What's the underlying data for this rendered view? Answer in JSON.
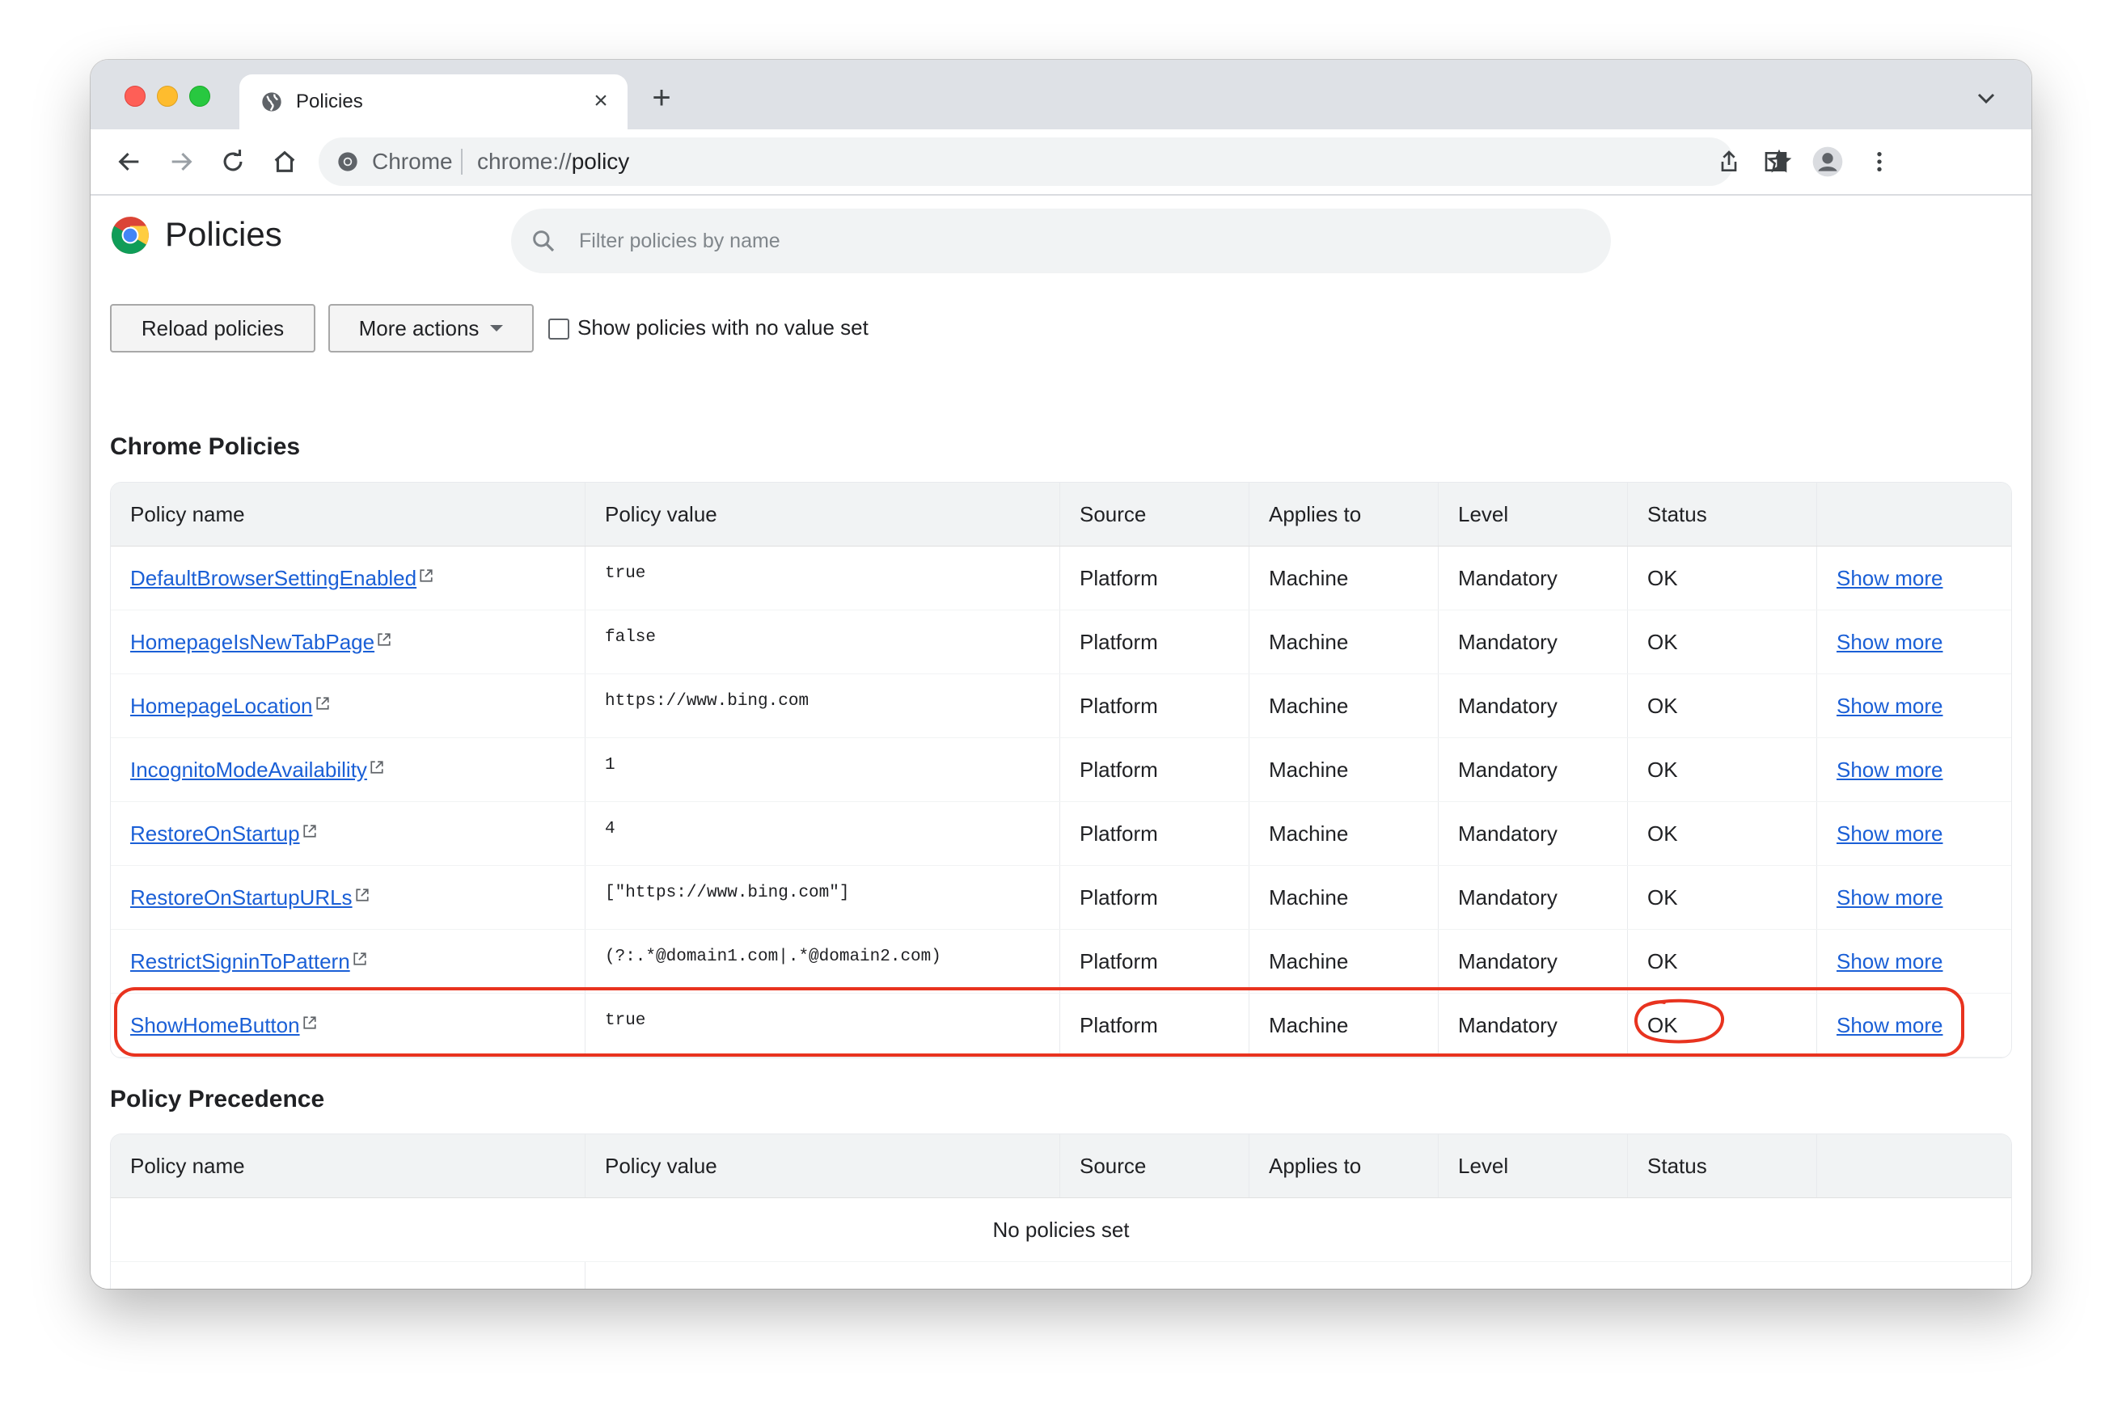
{
  "tab": {
    "title": "Policies"
  },
  "omnibox": {
    "site_label": "Chrome",
    "url_scheme": "chrome://",
    "url_path": "policy"
  },
  "page": {
    "title": "Policies",
    "filter_placeholder": "Filter policies by name",
    "reload_label": "Reload policies",
    "more_actions_label": "More actions",
    "show_unset_label": "Show policies with no value set",
    "show_unset_checked": false
  },
  "columns": [
    "Policy name",
    "Policy value",
    "Source",
    "Applies to",
    "Level",
    "Status"
  ],
  "chrome_policies": {
    "title": "Chrome Policies",
    "rows": [
      {
        "name": "DefaultBrowserSettingEnabled",
        "value": "true",
        "source": "Platform",
        "applies": "Machine",
        "level": "Mandatory",
        "status": "OK",
        "action": "Show more"
      },
      {
        "name": "HomepageIsNewTabPage",
        "value": "false",
        "source": "Platform",
        "applies": "Machine",
        "level": "Mandatory",
        "status": "OK",
        "action": "Show more"
      },
      {
        "name": "HomepageLocation",
        "value": "https://www.bing.com",
        "source": "Platform",
        "applies": "Machine",
        "level": "Mandatory",
        "status": "OK",
        "action": "Show more"
      },
      {
        "name": "IncognitoModeAvailability",
        "value": "1",
        "source": "Platform",
        "applies": "Machine",
        "level": "Mandatory",
        "status": "OK",
        "action": "Show more"
      },
      {
        "name": "RestoreOnStartup",
        "value": "4",
        "source": "Platform",
        "applies": "Machine",
        "level": "Mandatory",
        "status": "OK",
        "action": "Show more"
      },
      {
        "name": "RestoreOnStartupURLs",
        "value": "[\"https://www.bing.com\"]",
        "source": "Platform",
        "applies": "Machine",
        "level": "Mandatory",
        "status": "OK",
        "action": "Show more"
      },
      {
        "name": "RestrictSigninToPattern",
        "value": "(?:.*@domain1.com|.*@domain2.com)",
        "source": "Platform",
        "applies": "Machine",
        "level": "Mandatory",
        "status": "OK",
        "action": "Show more"
      },
      {
        "name": "ShowHomeButton",
        "value": "true",
        "source": "Platform",
        "applies": "Machine",
        "level": "Mandatory",
        "status": "OK",
        "action": "Show more"
      }
    ]
  },
  "policy_precedence": {
    "title": "Policy Precedence",
    "empty_text": "No policies set"
  },
  "colors": {
    "annotation": "#e8331f",
    "link": "#1a5fd6"
  }
}
